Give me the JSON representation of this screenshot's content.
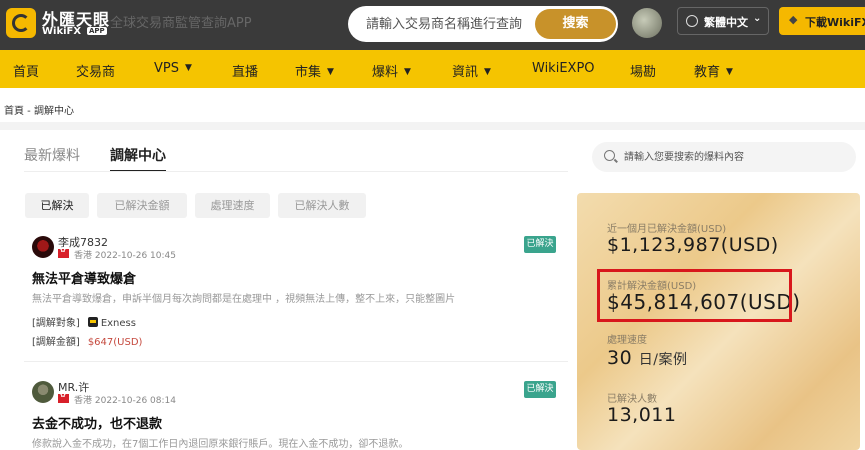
{
  "header": {
    "logo_cn": "外匯天眼",
    "logo_en": "WikiFX",
    "logo_badge": "APP",
    "tagline": "全球交易商監管查詢APP",
    "search_placeholder": "請輸入交易商名稱進行查詢",
    "search_button": "搜索",
    "language": "繁體中文",
    "download_button": "下載WikiFX"
  },
  "nav": {
    "items": [
      {
        "label": "首頁"
      },
      {
        "label": "交易商"
      },
      {
        "label": "VPS"
      },
      {
        "label": "直播"
      },
      {
        "label": "市集"
      },
      {
        "label": "爆料"
      },
      {
        "label": "資訊"
      },
      {
        "label": "WikiEXPO"
      },
      {
        "label": "場勘"
      },
      {
        "label": "教育"
      }
    ]
  },
  "breadcrumb": "首頁 - 調解中心",
  "tabs": [
    {
      "label": "最新爆料",
      "active": false
    },
    {
      "label": "調解中心",
      "active": true
    }
  ],
  "post_search_placeholder": "請輸入您要搜索的爆料內容",
  "filters": [
    {
      "label": "已解決",
      "active": true
    },
    {
      "label": "已解決金額",
      "active": false
    },
    {
      "label": "處理速度",
      "active": false
    },
    {
      "label": "已解決人數",
      "active": false
    }
  ],
  "posts": [
    {
      "user": "李成7832",
      "region": "香港",
      "time": "2022-10-26 10:45",
      "status": "已解決",
      "title": "無法平倉導致爆倉",
      "description": "無法平倉導致爆倉，申訴半個月每次詢問都是在處理中 ，視頻無法上傳，整不上來，只能整圖片",
      "target_label": "[調解對象]",
      "target_name": "Exness",
      "amount_label": "[調解金額]",
      "amount": "$647(USD)"
    },
    {
      "user": "MR.许",
      "region": "香港",
      "time": "2022-10-26 08:14",
      "status": "已解決",
      "title": "去金不成功，也不退款",
      "description": "修款說入金不成功，在7個工作日內退回原來銀行賬戶。現在入金不成功，卻不退款。"
    }
  ],
  "stats": {
    "monthly_label": "近一個月已解決金額(USD)",
    "monthly_value": "$1,123,987(USD)",
    "total_label": "累計解決金額(USD)",
    "total_value": "$45,814,607(USD)",
    "speed_label": "處理速度",
    "speed_value": "30",
    "speed_unit": "日/案例",
    "people_label": "已解決人數",
    "people_value": "13,011"
  },
  "colors": {
    "header_bg": "#3a3a3a",
    "nav_bg": "#f5c400",
    "accent": "#c8922a",
    "badge": "#3aa48d",
    "amount": "#c5493e",
    "highlight": "#d8171c"
  }
}
